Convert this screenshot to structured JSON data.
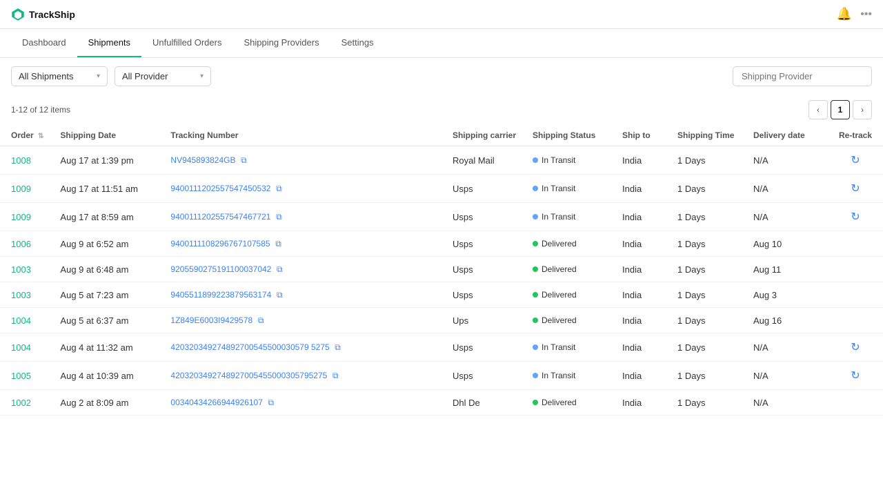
{
  "app": {
    "name": "TrackShip"
  },
  "nav": {
    "items": [
      {
        "label": "Dashboard",
        "active": false
      },
      {
        "label": "Shipments",
        "active": true
      },
      {
        "label": "Unfulfilled Orders",
        "active": false
      },
      {
        "label": "Shipping Providers",
        "active": false
      },
      {
        "label": "Settings",
        "active": false
      }
    ]
  },
  "toolbar": {
    "shipments_filter_label": "All Shipments",
    "provider_filter_label": "All Provider",
    "search_placeholder": "Shipping Provider",
    "chevron": "▾"
  },
  "pagination": {
    "info": "1-12 of 12 items",
    "current_page": "1",
    "prev_icon": "‹",
    "next_icon": "›"
  },
  "table": {
    "columns": [
      {
        "label": "Order",
        "sortable": true
      },
      {
        "label": "Shipping Date",
        "sortable": false
      },
      {
        "label": "Tracking Number",
        "sortable": false
      },
      {
        "label": "Shipping carrier",
        "sortable": false
      },
      {
        "label": "Shipping Status",
        "sortable": false
      },
      {
        "label": "Ship to",
        "sortable": false
      },
      {
        "label": "Shipping Time",
        "sortable": false
      },
      {
        "label": "Delivery date",
        "sortable": false
      },
      {
        "label": "Re-track",
        "sortable": false
      }
    ],
    "rows": [
      {
        "order": "1008",
        "shipping_date": "Aug 17 at 1:39 pm",
        "tracking_number": "NV945893824GB",
        "carrier": "Royal Mail",
        "status": "In Transit",
        "status_type": "transit",
        "ship_to": "India",
        "shipping_time": "1 Days",
        "delivery_date": "N/A",
        "retrack": true
      },
      {
        "order": "1009",
        "shipping_date": "Aug 17 at 11:51 am",
        "tracking_number": "9400111202557547450532",
        "carrier": "Usps",
        "status": "In Transit",
        "status_type": "transit",
        "ship_to": "India",
        "shipping_time": "1 Days",
        "delivery_date": "N/A",
        "retrack": true
      },
      {
        "order": "1009",
        "shipping_date": "Aug 17 at 8:59 am",
        "tracking_number": "9400111202557547467721",
        "carrier": "Usps",
        "status": "In Transit",
        "status_type": "transit",
        "ship_to": "India",
        "shipping_time": "1 Days",
        "delivery_date": "N/A",
        "retrack": true
      },
      {
        "order": "1006",
        "shipping_date": "Aug 9 at 6:52 am",
        "tracking_number": "9400111108296767107585",
        "carrier": "Usps",
        "status": "Delivered",
        "status_type": "delivered",
        "ship_to": "India",
        "shipping_time": "1 Days",
        "delivery_date": "Aug 10",
        "retrack": false
      },
      {
        "order": "1003",
        "shipping_date": "Aug 9 at 6:48 am",
        "tracking_number": "9205590275191100037042",
        "carrier": "Usps",
        "status": "Delivered",
        "status_type": "delivered",
        "ship_to": "India",
        "shipping_time": "1 Days",
        "delivery_date": "Aug 11",
        "retrack": false
      },
      {
        "order": "1003",
        "shipping_date": "Aug 5 at 7:23 am",
        "tracking_number": "9405511899223879563174",
        "carrier": "Usps",
        "status": "Delivered",
        "status_type": "delivered",
        "ship_to": "India",
        "shipping_time": "1 Days",
        "delivery_date": "Aug 3",
        "retrack": false
      },
      {
        "order": "1004",
        "shipping_date": "Aug 5 at 6:37 am",
        "tracking_number": "1Z849E6003I9429578",
        "carrier": "Ups",
        "status": "Delivered",
        "status_type": "delivered",
        "ship_to": "India",
        "shipping_time": "1 Days",
        "delivery_date": "Aug 16",
        "retrack": false
      },
      {
        "order": "1004",
        "shipping_date": "Aug 4 at 11:32 am",
        "tracking_number": "420320349274892700545500030579 5275",
        "carrier": "Usps",
        "status": "In Transit",
        "status_type": "transit",
        "ship_to": "India",
        "shipping_time": "1 Days",
        "delivery_date": "N/A",
        "retrack": true
      },
      {
        "order": "1005",
        "shipping_date": "Aug 4 at 10:39 am",
        "tracking_number": "4203203492748927005455000305795275",
        "carrier": "Usps",
        "status": "In Transit",
        "status_type": "transit",
        "ship_to": "India",
        "shipping_time": "1 Days",
        "delivery_date": "N/A",
        "retrack": true
      },
      {
        "order": "1002",
        "shipping_date": "Aug 2 at 8:09 am",
        "tracking_number": "00340434266944926107",
        "carrier": "Dhl De",
        "status": "Delivered",
        "status_type": "delivered",
        "ship_to": "India",
        "shipping_time": "1 Days",
        "delivery_date": "N/A",
        "retrack": false
      }
    ]
  },
  "icons": {
    "copy": "⧉",
    "retrack": "↻",
    "sort": "⇅"
  }
}
